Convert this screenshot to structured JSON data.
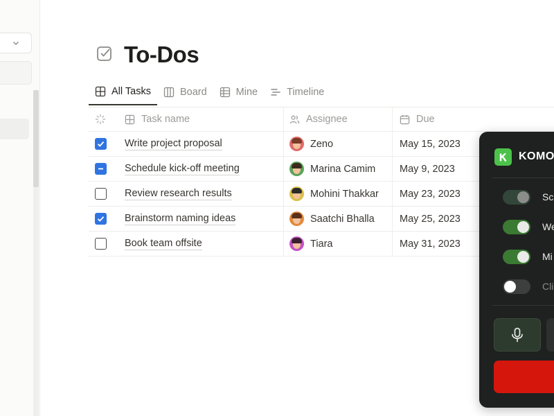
{
  "page": {
    "title": "To-Dos"
  },
  "tabs": [
    {
      "label": "All Tasks",
      "icon": "table-icon",
      "active": true
    },
    {
      "label": "Board",
      "icon": "board-icon",
      "active": false
    },
    {
      "label": "Mine",
      "icon": "table-icon",
      "active": false
    },
    {
      "label": "Timeline",
      "icon": "timeline-icon",
      "active": false
    }
  ],
  "table": {
    "columns": {
      "name": "Task name",
      "assignee": "Assignee",
      "due": "Due"
    },
    "rows": [
      {
        "status": "checked",
        "name": "Write project proposal",
        "assignee": "Zeno",
        "due": "May 15, 2023"
      },
      {
        "status": "partial",
        "name": "Schedule kick-off meeting",
        "assignee": "Marina Camim",
        "due": "May 9, 2023"
      },
      {
        "status": "unchecked",
        "name": "Review research results",
        "assignee": "Mohini Thakkar",
        "due": "May 23, 2023"
      },
      {
        "status": "checked",
        "name": "Brainstorm naming ideas",
        "assignee": "Saatchi Bhalla",
        "due": "May 25, 2023"
      },
      {
        "status": "unchecked",
        "name": "Book team offsite",
        "assignee": "Tiara",
        "due": "May 31, 2023"
      }
    ]
  },
  "panel": {
    "brand": "KOMO",
    "options": [
      {
        "label": "Sc",
        "state": "dim"
      },
      {
        "label": "We",
        "state": "on"
      },
      {
        "label": "Mi",
        "state": "on"
      },
      {
        "label": "Cli",
        "state": "off"
      }
    ]
  },
  "colors": {
    "accent": "#2f74e0",
    "brand": "#4cc24a",
    "record": "#d5160d",
    "panel_bg": "#1f2120"
  }
}
